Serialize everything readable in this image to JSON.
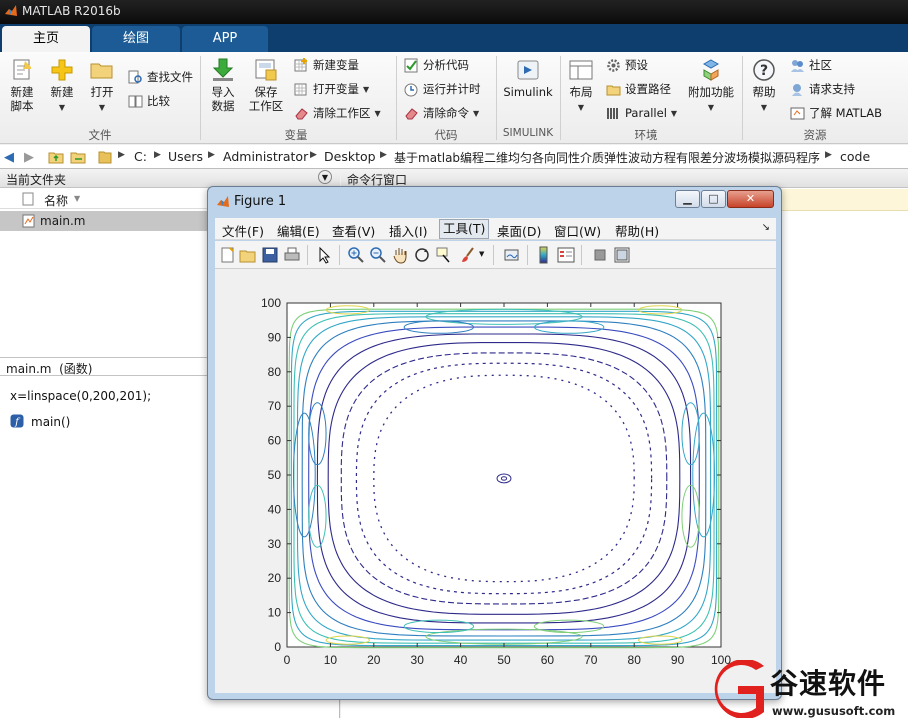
{
  "app": {
    "title": "MATLAB R2016b"
  },
  "tabs": [
    {
      "label": "主页",
      "active": true
    },
    {
      "label": "绘图",
      "active": false
    },
    {
      "label": "APP",
      "active": false
    }
  ],
  "ribbon": {
    "file": {
      "new_script": "新建\n脚本",
      "new": "新建",
      "open": "打开",
      "find_files": "查找文件",
      "compare": "比较",
      "group": "文件"
    },
    "variable": {
      "import": "导入\n数据",
      "save_ws": "保存\n工作区",
      "new_var": "新建变量",
      "open_var": "打开变量",
      "clear_ws": "清除工作区",
      "group": "变量"
    },
    "code": {
      "analyze": "分析代码",
      "run_time": "运行并计时",
      "clear_cmd": "清除命令",
      "group": "代码"
    },
    "simulink": {
      "label": "Simulink",
      "group": "SIMULINK"
    },
    "env": {
      "layout": "布局",
      "prefs": "预设",
      "set_path": "设置路径",
      "parallel": "Parallel",
      "addons": "附加功能",
      "group": "环境"
    },
    "resources": {
      "help": "帮助",
      "community": "社区",
      "support": "请求支持",
      "learn": "了解 MATLAB",
      "group": "资源"
    }
  },
  "address": {
    "crumbs": [
      "C:",
      "Users",
      "Administrator",
      "Desktop",
      "基于matlab编程二维均匀各向同性介质弹性波动方程有限差分波场模拟源码程序",
      "code"
    ]
  },
  "current_folder": {
    "title": "当前文件夹",
    "column": "名称",
    "files": [
      "main.m"
    ]
  },
  "details": {
    "title": "main.m  (函数)",
    "line1": "x=linspace(0,200,201);",
    "line2": "main()"
  },
  "command_window": {
    "title": "命令行窗口"
  },
  "figure": {
    "title": "Figure 1",
    "menu": [
      "文件(F)",
      "编辑(E)",
      "查看(V)",
      "插入(I)",
      "工具(T)",
      "桌面(D)",
      "窗口(W)",
      "帮助(H)"
    ],
    "selected_menu": "工具(T)"
  },
  "chart_data": {
    "type": "contour",
    "title": "",
    "xlabel": "",
    "ylabel": "",
    "xlim": [
      0,
      100
    ],
    "ylim": [
      0,
      100
    ],
    "xticks": [
      0,
      10,
      20,
      30,
      40,
      50,
      60,
      70,
      80,
      90,
      100
    ],
    "yticks": [
      0,
      10,
      20,
      30,
      40,
      50,
      60,
      70,
      80,
      90,
      100
    ],
    "center": [
      50,
      49
    ],
    "colormap": [
      "#2e2a8a",
      "#3b4cc0",
      "#2f7fbf",
      "#35a7c8",
      "#3fc0b4",
      "#7fcf7a",
      "#e0d54a"
    ],
    "grid": false
  },
  "watermark": {
    "brand": "谷速软件",
    "url": "www.gususoft.com",
    "color": "#e0211e"
  }
}
